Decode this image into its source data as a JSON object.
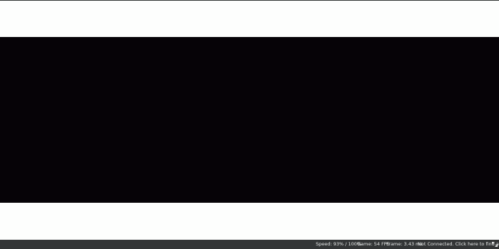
{
  "status_bar": {
    "speed": "Speed: 93% / 100%",
    "game_fps": "Game: 54 FPS",
    "frame_time": "Frame: 3.43 ms",
    "netplay": "Not Connected. Click here to find a room!",
    "fullscreen_icon": "expand-icon"
  },
  "colors": {
    "background": "#fdfefd",
    "viewport": "#060307",
    "status_bar_bg": "#333536",
    "status_text": "#e8eaea"
  }
}
